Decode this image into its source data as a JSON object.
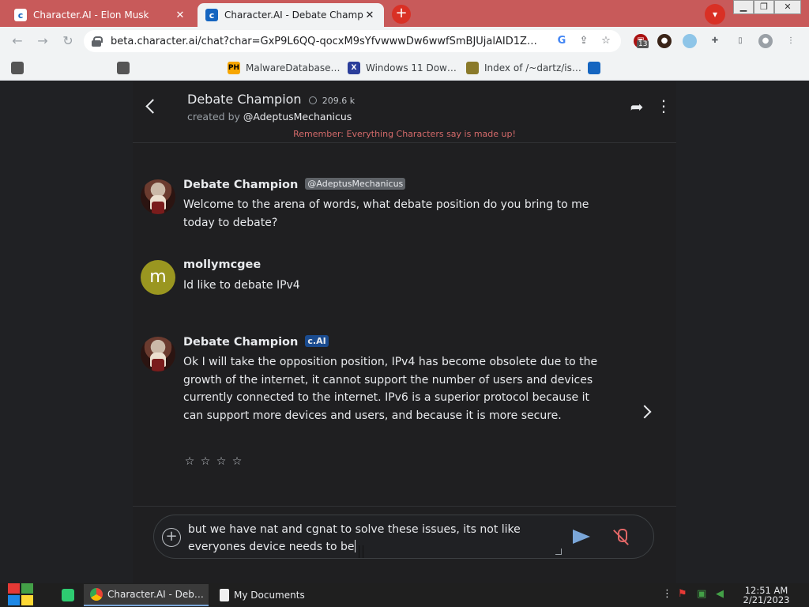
{
  "browser": {
    "tabs": [
      {
        "title": "Character.AI - Elon Musk",
        "active": false
      },
      {
        "title": "Character.AI - Debate Champic",
        "active": true
      }
    ],
    "url": "beta.character.ai/chat?char=GxP9L6QQ-qocxM9sYfvwwwDw6wwfSmBJUjalAID1Z…",
    "extension_badge": "13",
    "bookmarks": [
      {
        "label": "",
        "icon": "bookmark-icon-1",
        "icon_text": ""
      },
      {
        "label": "",
        "icon": "bookmark-icon-2",
        "icon_text": ""
      },
      {
        "label": "MalwareDatabase…",
        "icon": "ph-icon",
        "icon_text": "PH"
      },
      {
        "label": "Windows 11 Dow…",
        "icon": "x-icon",
        "icon_text": "X"
      },
      {
        "label": "Index of /~dartz/is…",
        "icon": "folder-icon",
        "icon_text": ""
      },
      {
        "label": "",
        "icon": "character-ai-icon",
        "icon_text": ""
      }
    ]
  },
  "chat": {
    "character_name": "Debate Champion",
    "chat_count": "209.6 k",
    "created_by_prefix": "created by",
    "creator": "@AdeptusMechanicus",
    "disclaimer": "Remember: Everything Characters say is made up!",
    "messages": [
      {
        "author": "Debate Champion",
        "tag": "@AdeptusMechanicus",
        "avatar": "portrait",
        "text": "Welcome to the arena of words, what debate position do you bring to me today to debate?"
      },
      {
        "author": "mollymcgee",
        "tag": "",
        "avatar": "m",
        "text": "Id like to debate IPv4"
      },
      {
        "author": "Debate Champion",
        "tag": "c.AI",
        "avatar": "portrait",
        "text": "Ok I will take the opposition position, IPv4 has become obsolete due to the growth of the internet, it cannot support the number of users and devices currently connected to the internet. IPv6 is a superior protocol because it can support more devices and users, and because it is more secure.",
        "rating_stars": [
          "☆",
          "☆",
          "☆",
          "☆"
        ]
      }
    ],
    "input_text": "but we have nat and cgnat to solve these issues, its not like everyones device needs to be"
  },
  "taskbar": {
    "items": [
      {
        "label": "Character.AI - Deb…",
        "active": true
      },
      {
        "label": "My Documents",
        "active": false
      }
    ],
    "time": "12:51 AM",
    "date": "2/21/2023"
  },
  "colors": {
    "tabstrip": "#c85a5a",
    "page_bg": "#202124",
    "disclaimer": "#d46a6a",
    "ai_tag": "#1a4b8f",
    "send": "#7aa6d8",
    "mic": "#e06666"
  }
}
